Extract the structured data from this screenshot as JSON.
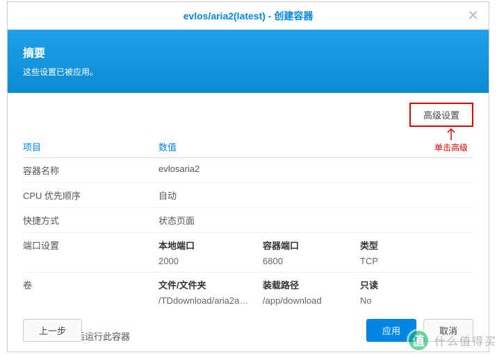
{
  "titlebar": {
    "title": "evlos/aria2(latest) - 创建容器"
  },
  "banner": {
    "title": "摘要",
    "subtitle": "这些设置已被应用。"
  },
  "advanced_button": "高级设置",
  "annotation_text": "单击高级",
  "table": {
    "header_item": "项目",
    "header_value": "数值",
    "rows": [
      {
        "label": "容器名称",
        "value": "evlosaria2"
      },
      {
        "label": "CPU 优先顺序",
        "value": "自动"
      },
      {
        "label": "快捷方式",
        "value": "状态页面"
      }
    ],
    "port_section": {
      "label": "端口设置",
      "headers": {
        "local": "本地端口",
        "container": "容器端口",
        "type": "类型"
      },
      "values": {
        "local": "2000",
        "container": "6800",
        "type": "TCP"
      }
    },
    "volume_section": {
      "label": "卷",
      "headers": {
        "file": "文件/文件夹",
        "mount": "装载路径",
        "readonly": "只读"
      },
      "values": {
        "file": "/TDdownload/aria2a…",
        "mount": "/app/download",
        "readonly": "No"
      }
    }
  },
  "checkbox_label": "向导完成后运行此容器",
  "footer": {
    "prev": "上一步",
    "apply": "应用",
    "cancel": "取消"
  },
  "watermark": {
    "badge": "值",
    "text": "什么值得买"
  }
}
